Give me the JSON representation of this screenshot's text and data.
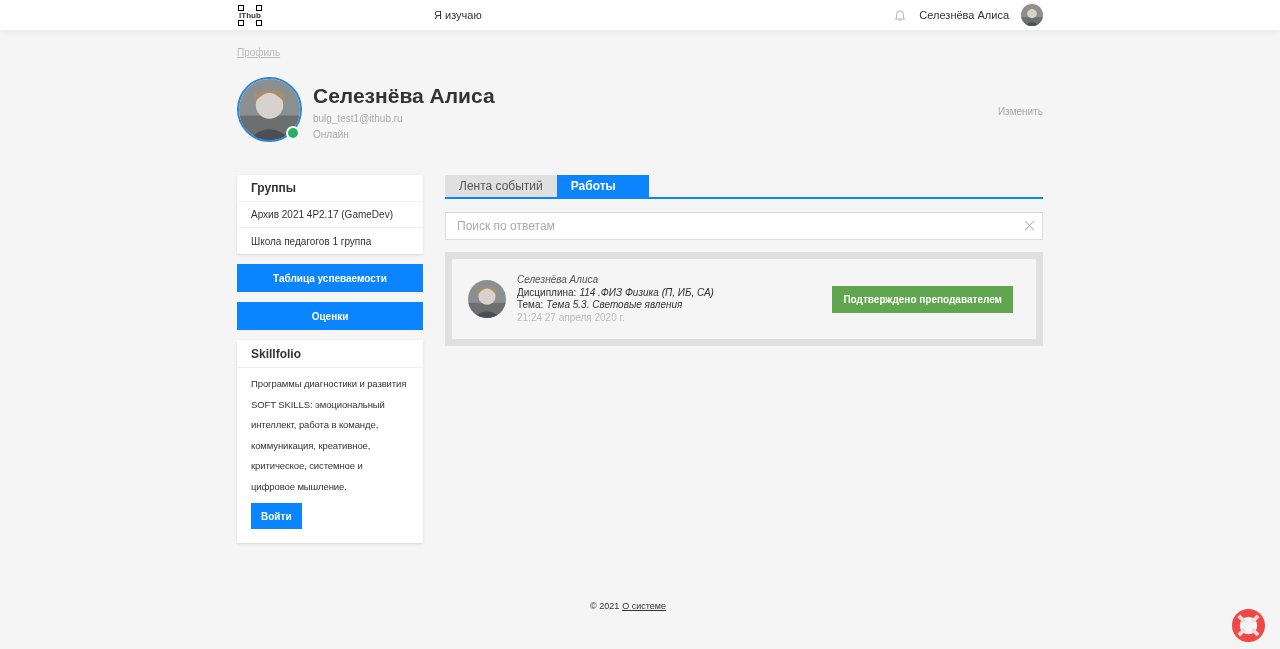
{
  "header": {
    "logo": "IThub",
    "nav": "Я изучаю",
    "user_name": "Селезнёва Алиса"
  },
  "breadcrumb": "Профиль",
  "profile": {
    "name": "Селезнёва Алиса",
    "email": "bulg_test1@ithub.ru",
    "status": "Онлайн",
    "online": true,
    "edit": "Изменить"
  },
  "groups": {
    "title": "Группы",
    "items": [
      "Архив 2021 4Р2.17 (GameDev)",
      "Школа педагогов 1 группа"
    ]
  },
  "buttons": [
    "Таблица успеваемости",
    "Оценки"
  ],
  "skillfolio": {
    "title": "Skillfolio",
    "text": "Программы диагностики и развития SOFT SKILLS: эмоциональный интеллект, работа в команде, коммуникация, креативное, критическое, системное и цифровое мышление.",
    "button": "Войти"
  },
  "tabs": [
    {
      "label": "Лента событий",
      "selected": false
    },
    {
      "label": "Работы",
      "selected": true
    }
  ],
  "search": {
    "placeholder": "Поиск по ответам"
  },
  "works": [
    {
      "author": "Селезнёва Алиса",
      "discipline_label": "Дисциплина:",
      "discipline": "114 .ФИЗ Физика (П, ИБ, СА)",
      "topic_label": "Тема:",
      "topic": "Тема 5.3. Световые явления",
      "date": "21:24 27 апреля 2020 г.",
      "status": "Подтверждено преподавателем"
    }
  ],
  "footer": {
    "copyright": "© 2021",
    "link": "О системе"
  }
}
